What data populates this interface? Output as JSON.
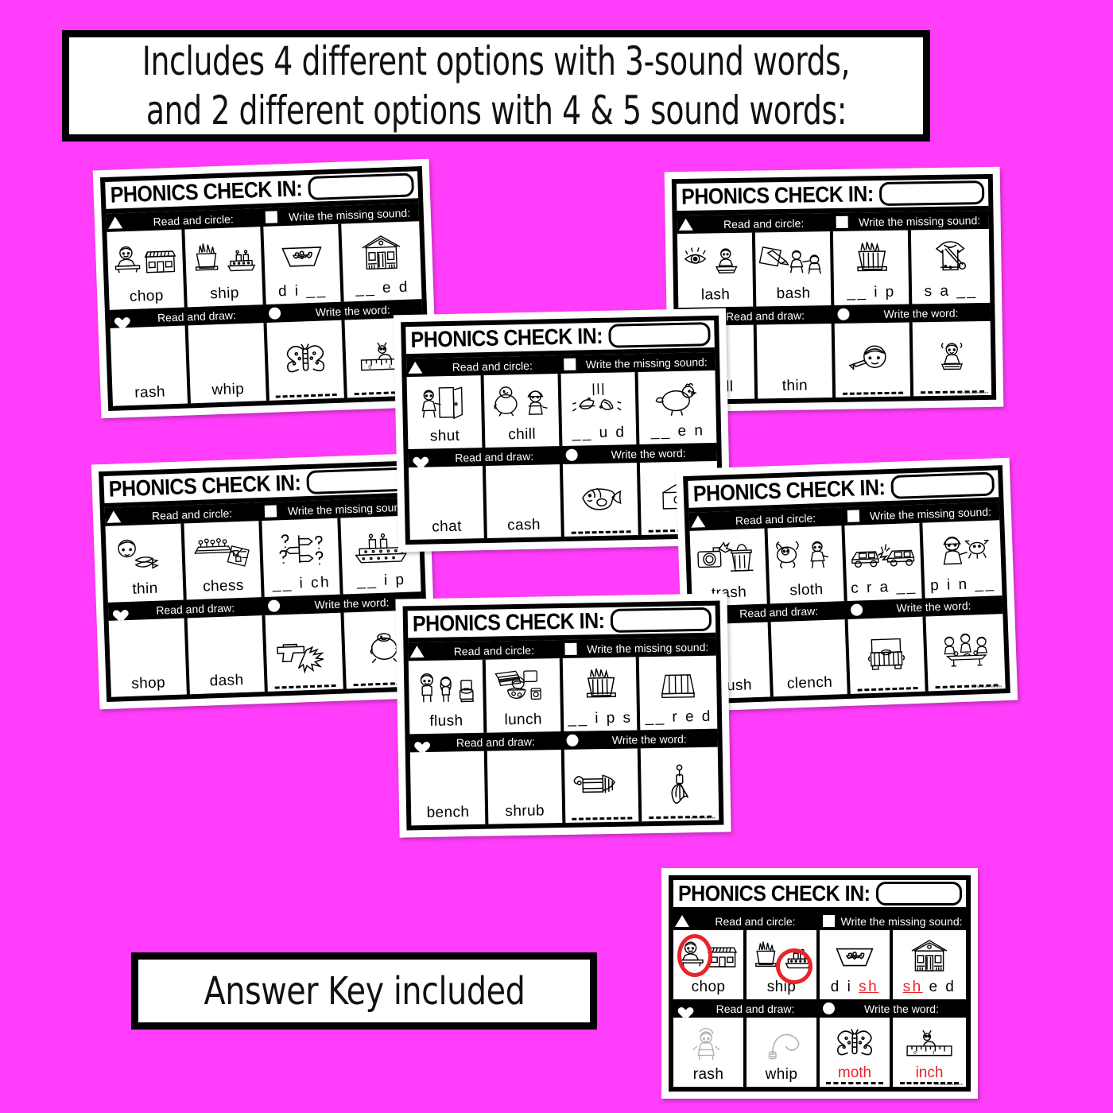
{
  "background_color": "#ff3dfa",
  "accent_red": "#e8232a",
  "top_banner": {
    "line1": "Includes 4 different options with 3-sound words,",
    "line2": "and 2 different options with 4 & 5 sound words:"
  },
  "answer_banner": {
    "text": "Answer Key included"
  },
  "card_labels": {
    "title": "PHONICS CHECK IN:",
    "read_and_circle": "Read and circle:",
    "write_missing_sound": "Write the missing sound:",
    "read_and_draw": "Read and draw:",
    "write_the_word": "Write the word:",
    "blank_line": "___________",
    "copyright": "© Mrs Learning Bee"
  },
  "icons": {
    "triangle": "triangle-icon",
    "square": "square-icon",
    "heart": "heart-icon",
    "circle": "circle-icon"
  },
  "cards": [
    {
      "id": "card-chop-ship",
      "name_box_value": "",
      "read_and_circle": [
        "chop",
        "ship"
      ],
      "missing_sound": [
        "d i __",
        "__ e d"
      ],
      "read_and_draw": [
        "rash",
        "whip"
      ],
      "write_the_word": [
        "___________",
        "___________"
      ],
      "pictures": {
        "circle1": "boy-chopping-and-shop",
        "circle2": "fries-and-ship",
        "missing1": "dish-bowl",
        "missing2": "shed-house",
        "word1": "moth-butterfly",
        "word2": "inch-ruler-bug"
      }
    },
    {
      "id": "card-lash-bash",
      "name_box_value": "",
      "read_and_circle": [
        "lash",
        "bash"
      ],
      "missing_sound": [
        "__ i p",
        "s a __"
      ],
      "read_and_draw": [
        "shell",
        "thin"
      ],
      "write_the_word": [
        "___________",
        "___________"
      ],
      "pictures": {
        "circle1": "eyelash-and-girl-eating",
        "circle2": "paper-pencil-and-kids-bashing",
        "missing1": "chips-fries",
        "missing2": "sash-dress",
        "word1": "thin-boy-face",
        "word2": "girl-with-dish"
      }
    },
    {
      "id": "card-shut-chill",
      "name_box_value": "",
      "read_and_circle": [
        "shut",
        "chill"
      ],
      "missing_sound": [
        "__ u d",
        "__ e n"
      ],
      "read_and_draw": [
        "chat",
        "cash"
      ],
      "write_the_word": [
        "___________",
        "___________"
      ],
      "pictures": {
        "circle1": "boy-shutting-door",
        "circle2": "chick-and-cold-girl",
        "missing1": "mud-splash-watermelon",
        "missing2": "hen",
        "word1": "fish",
        "word2": "hidden"
      }
    },
    {
      "id": "card-thin-chess",
      "name_box_value": "",
      "read_and_circle": [
        "thin",
        "chess"
      ],
      "missing_sound": [
        "__ i ch",
        "__ i p"
      ],
      "read_and_draw": [
        "shop",
        "dash"
      ],
      "write_the_word": [
        "___________",
        "___________"
      ],
      "pictures": {
        "circle1": "thin-boy-and-ribbon",
        "circle2": "chess-board-and-checklist",
        "missing1": "which-signposts-questions",
        "missing2": "ship",
        "word1": "shot-gun-bang",
        "word2": "chick"
      }
    },
    {
      "id": "card-trash-sloth",
      "name_box_value": "",
      "read_and_circle": [
        "trash",
        "sloth"
      ],
      "missing_sound": [
        "c r a __",
        "p i n __"
      ],
      "read_and_draw": [
        "brush",
        "clench"
      ],
      "write_the_word": [
        "___________",
        "___________"
      ],
      "pictures": {
        "circle1": "camera-flash-and-trash-can",
        "circle2": "sloth-and-boy",
        "missing1": "car-crash",
        "missing2": "boy-pinching-crab",
        "word1": "trunk-chest",
        "word2": "family-lunch-table"
      }
    },
    {
      "id": "card-flush-lunch",
      "name_box_value": "",
      "read_and_circle": [
        "flush",
        "lunch"
      ],
      "missing_sound": [
        "__ i p s",
        "__ r e d"
      ],
      "read_and_draw": [
        "bench",
        "shrub"
      ],
      "write_the_word": [
        "___________",
        "___________"
      ],
      "pictures": {
        "circle1": "boy-and-girl-flushing-toilet",
        "circle2": "lunch-sandwich-and-soup",
        "missing1": "chips-fries",
        "missing2": "shred-cheese",
        "word1": "brush",
        "word2": "whisk"
      }
    }
  ],
  "answer_key_card": {
    "id": "card-answer-key",
    "name_box_value": "",
    "read_and_circle": [
      "chop",
      "ship"
    ],
    "circled": [
      "chop",
      "ship"
    ],
    "missing_sound": [
      {
        "prefix": "d i ",
        "answer": "sh",
        "suffix": ""
      },
      {
        "prefix": "",
        "answer": "sh",
        "suffix": " e d"
      }
    ],
    "read_and_draw": [
      "rash",
      "whip"
    ],
    "write_the_word": [
      "moth",
      "inch"
    ],
    "pictures": {
      "circle1": "boy-chopping-and-shop",
      "circle2": "fries-and-ship",
      "missing1": "dish-bowl",
      "missing2": "shed-house",
      "draw1": "girl-with-rash-faint",
      "draw2": "whip-faint",
      "word1": "moth-butterfly",
      "word2": "inch-ruler-bug"
    }
  }
}
